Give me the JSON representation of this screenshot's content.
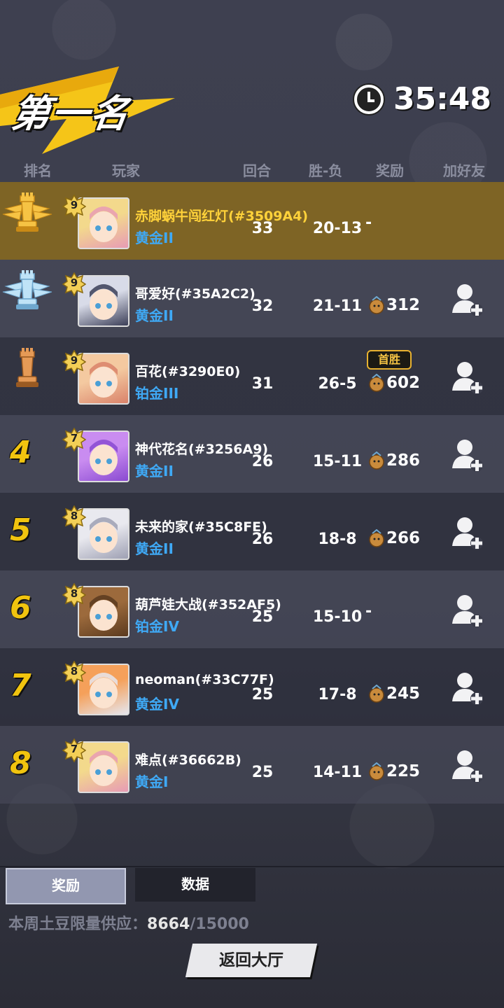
{
  "header": {
    "rank_title": "第一名",
    "timer": "35:48"
  },
  "columns": {
    "rank": "排名",
    "player": "玩家",
    "rounds": "回合",
    "win_loss": "胜-负",
    "reward": "奖励",
    "add_friend": "加好友"
  },
  "rows": [
    {
      "rank": "",
      "trophy": "gold",
      "level": "9",
      "name": "赤脚蜗牛闯红灯(#3509A4)",
      "tier": "黄金II",
      "rounds": "33",
      "win_loss": "20-13",
      "reward": "-",
      "first_win": "",
      "me": true
    },
    {
      "rank": "",
      "trophy": "silver",
      "level": "9",
      "name": "哥爱好(#35A2C2)",
      "tier": "黄金II",
      "rounds": "32",
      "win_loss": "21-11",
      "reward": "312",
      "first_win": ""
    },
    {
      "rank": "",
      "trophy": "bronze",
      "level": "9",
      "name": "百花(#3290E0)",
      "tier": "铂金III",
      "rounds": "31",
      "win_loss": "26-5",
      "reward": "602",
      "first_win": "首胜"
    },
    {
      "rank": "4",
      "trophy": "",
      "level": "7",
      "name": "神代花名(#3256A9)",
      "tier": "黄金II",
      "rounds": "26",
      "win_loss": "15-11",
      "reward": "286",
      "first_win": ""
    },
    {
      "rank": "5",
      "trophy": "",
      "level": "8",
      "name": "未来的家(#35C8FE)",
      "tier": "黄金II",
      "rounds": "26",
      "win_loss": "18-8",
      "reward": "266",
      "first_win": ""
    },
    {
      "rank": "6",
      "trophy": "",
      "level": "8",
      "name": "葫芦娃大战(#352AF5)",
      "tier": "铂金IV",
      "rounds": "25",
      "win_loss": "15-10",
      "reward": "-",
      "first_win": ""
    },
    {
      "rank": "7",
      "trophy": "",
      "level": "8",
      "name": "neoman(#33C77F)",
      "tier": "黄金IV",
      "rounds": "25",
      "win_loss": "17-8",
      "reward": "245",
      "first_win": ""
    },
    {
      "rank": "8",
      "trophy": "",
      "level": "7",
      "name": "难点(#36662B)",
      "tier": "黄金I",
      "rounds": "25",
      "win_loss": "14-11",
      "reward": "225",
      "first_win": ""
    }
  ],
  "tabs": {
    "reward": "奖励",
    "data": "数据"
  },
  "supply": {
    "label": "本周土豆限量供应：",
    "current": "8664",
    "total": "/15000"
  },
  "back_button": "返回大厅",
  "colors": {
    "accent_yellow": "#f1c40f",
    "tier_blue": "#3fa9f5",
    "highlight_row": "#7e6425"
  }
}
